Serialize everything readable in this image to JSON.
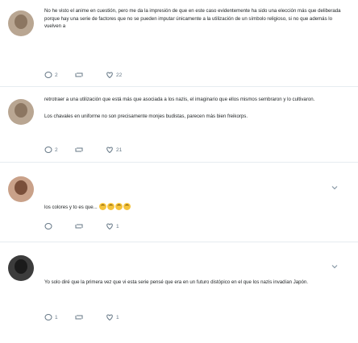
{
  "tweets": [
    {
      "paragraphs": [
        "No he visto el anime en cuestión, pero me da la impresión de que en este caso evidentemente ha sido una elección más que deliberada porque hay una serie de factores que no se pueden imputar únicamente a la utilización de un símbolo religioso, si no que además lo vuelven a"
      ],
      "reply_count": "2",
      "retweet_count": "",
      "like_count": "22"
    },
    {
      "paragraphs": [
        "retrotraer a una utilización que está más que asociada a los nazis, el imaginario que ellos mismos sembraron y lo cultivaron.",
        "Los chavales en uniforme no son precisamente monjes budistas, parecen más bien freikorps."
      ],
      "reply_count": "2",
      "retweet_count": "",
      "like_count": "21"
    },
    {
      "paragraphs": [
        "los colores y to es que... "
      ],
      "emoji_names": [
        "grimacing-face-emoji",
        "grimacing-face-emoji",
        "grimacing-face-emoji",
        "grimacing-face-emoji"
      ],
      "reply_count": "",
      "retweet_count": "",
      "like_count": "1"
    },
    {
      "paragraphs": [
        "Yo solo diré que la primera vez que vi esta serie pensé que era en un futuro distópico en el que los nazis invadían Japón."
      ],
      "reply_count": "1",
      "retweet_count": "",
      "like_count": "1"
    }
  ],
  "colors": {
    "action_gray": "#657786",
    "divider": "#e6ecf0",
    "text": "#1c2022"
  }
}
